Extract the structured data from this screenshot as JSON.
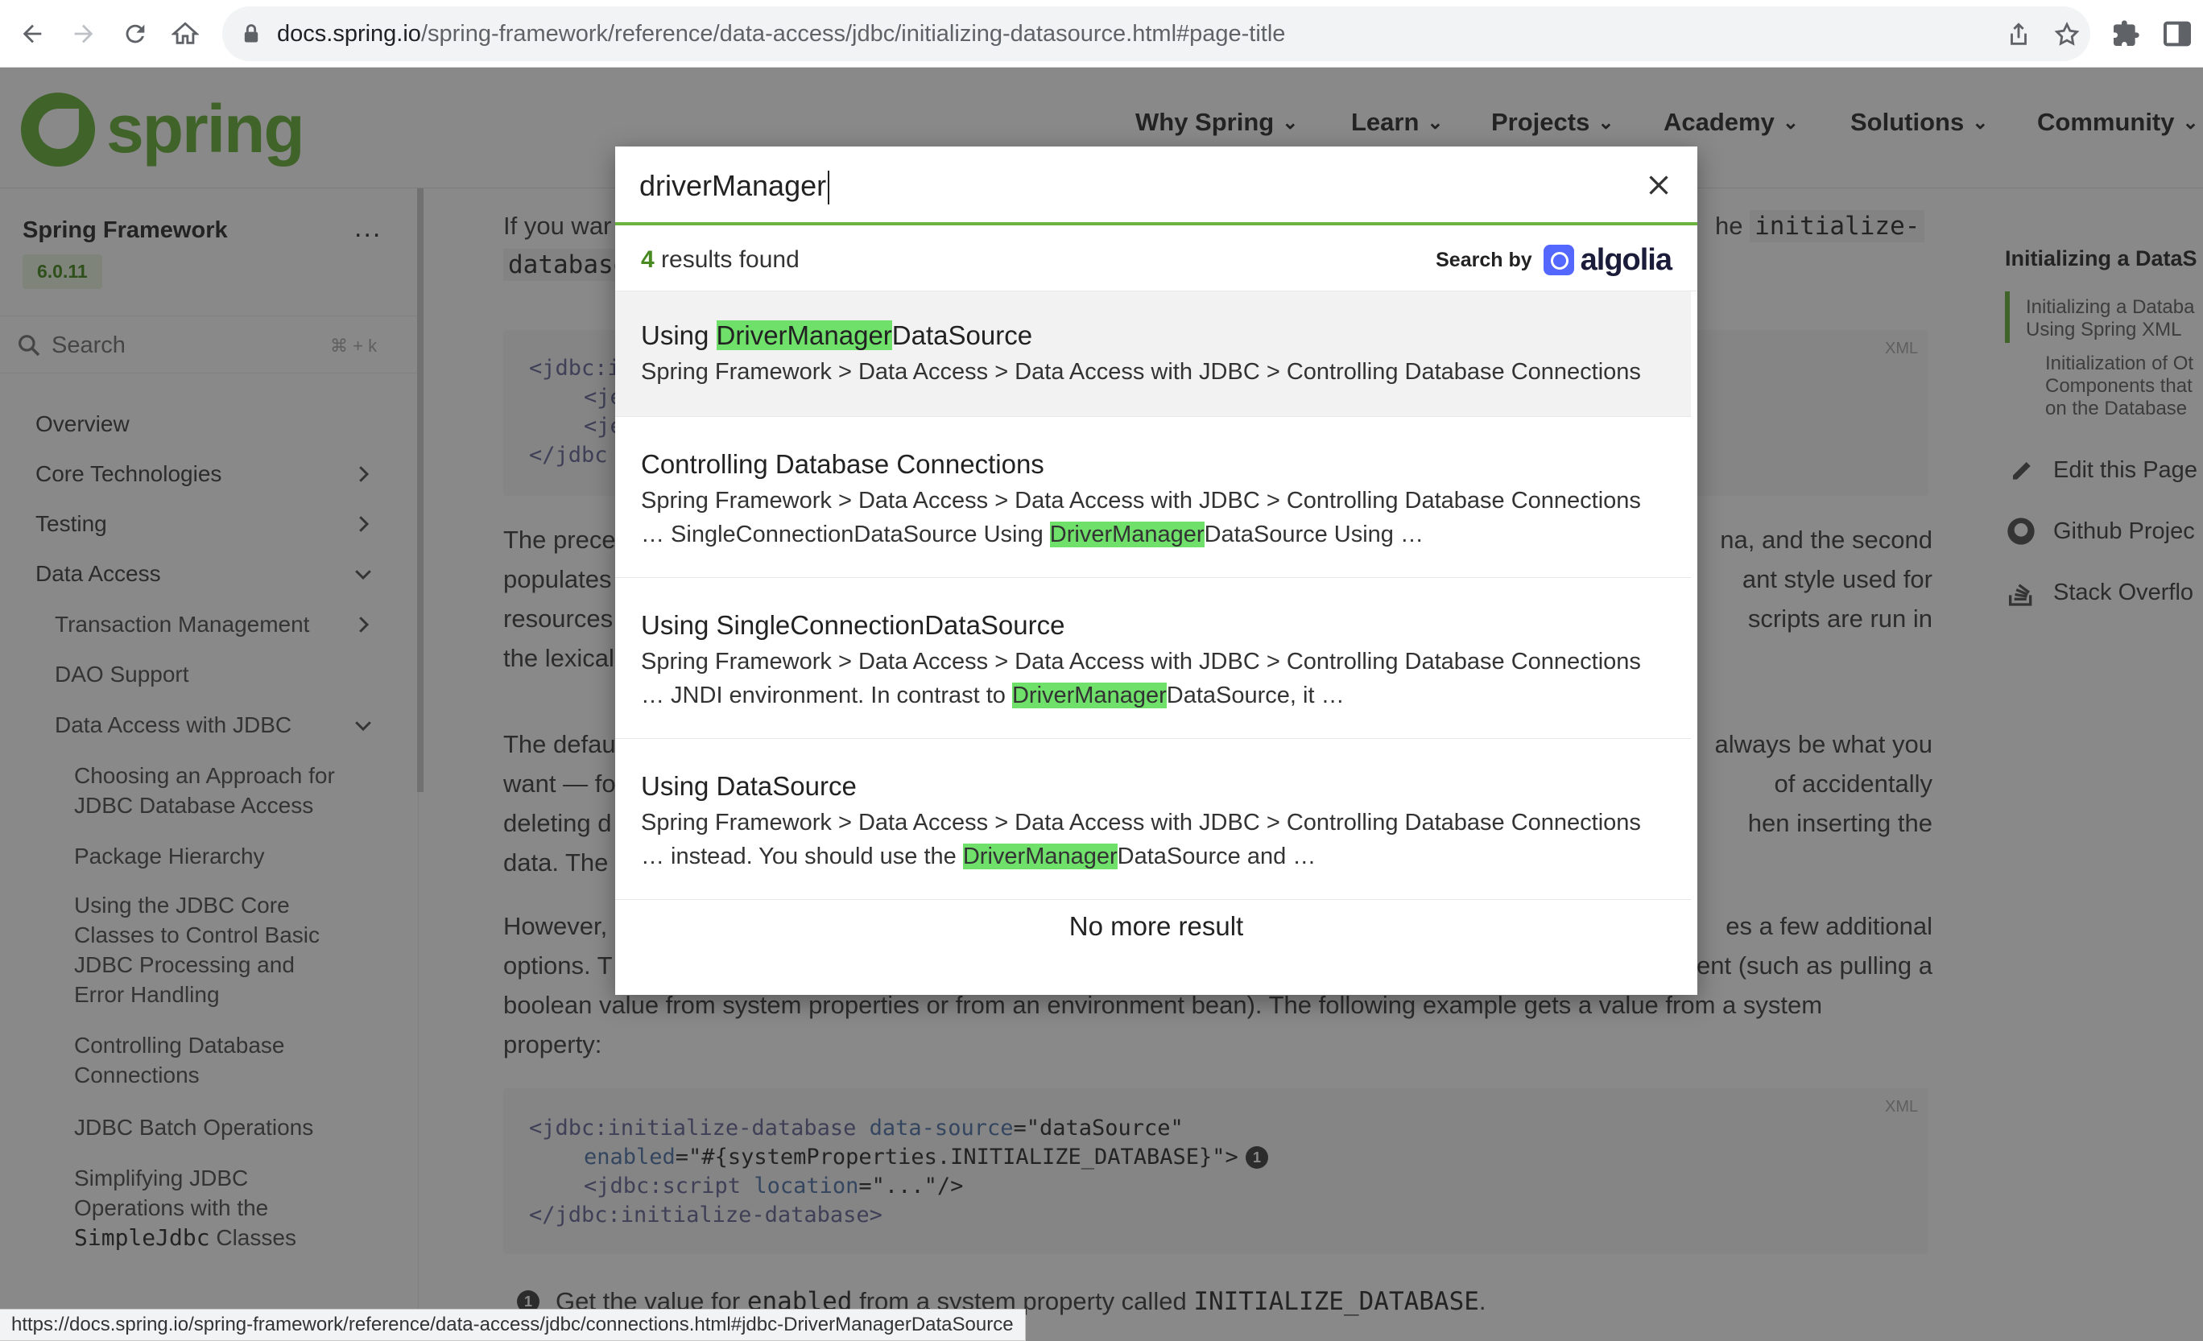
{
  "browser": {
    "url_host": "docs.spring.io",
    "url_path": "/spring-framework/reference/data-access/jdbc/initializing-datasource.html#page-title",
    "status_url": "https://docs.spring.io/spring-framework/reference/data-access/jdbc/connections.html#jdbc-DriverManagerDataSource"
  },
  "nav": {
    "logo": "spring",
    "menu": [
      "Why Spring",
      "Learn",
      "Projects",
      "Academy",
      "Solutions",
      "Community"
    ]
  },
  "sidebar": {
    "title": "Spring Framework",
    "more": "...",
    "version": "6.0.11",
    "search_label": "Search",
    "search_shortcut": "⌘ + k",
    "items": [
      {
        "label": "Overview"
      },
      {
        "label": "Core Technologies"
      },
      {
        "label": "Testing"
      },
      {
        "label": "Data Access"
      },
      {
        "label": "Transaction Management"
      },
      {
        "label": "DAO Support"
      },
      {
        "label": "Data Access with JDBC"
      },
      {
        "label": "Choosing an Approach for JDBC Database Access"
      },
      {
        "label": "Package Hierarchy"
      },
      {
        "label": "Using the JDBC Core Classes to Control Basic JDBC Processing and Error Handling"
      },
      {
        "label": "Controlling Database Connections"
      },
      {
        "label": "JDBC Batch Operations"
      },
      {
        "label": "Simplifying JDBC Operations with the"
      },
      {
        "label": "SimpleJdbc"
      },
      {
        "label": "Classes"
      }
    ]
  },
  "content": {
    "p1_start": "If you war",
    "p1_end": "he",
    "p1_code": "initialize-",
    "p1_code2": "database",
    "code1_lines": [
      "<jdbc:i",
      "<je",
      "<je",
      "</jdbc"
    ],
    "p2_lines_left": [
      "The prece",
      "populates",
      "resources",
      "the lexical"
    ],
    "p2_lines_right": [
      "na, and the second",
      "ant style used for",
      "scripts are run in"
    ],
    "p3_lines_left": [
      "The defau",
      "want — fo",
      "deleting d",
      "data. The"
    ],
    "p3_lines_right": [
      "always be what you",
      "of accidentally",
      "hen inserting the"
    ],
    "p4_line1_left": "However,",
    "p4_line1_right": "es a few additional",
    "p4_line2_left": "options. T",
    "p4_line2_right": "ent (such as pulling a",
    "p4_line3": "boolean value from system properties or from an environment bean). The following example gets a value from a system",
    "p4_line4": "property:",
    "xml_label": "XML",
    "code2": {
      "l1_tag": "<jdbc:initialize-database",
      "l1_attr": "data-source",
      "l1_val": "=\"dataSource\"",
      "l2_attr": "enabled",
      "l2_val": "=\"#{systemProperties.INITIALIZE_DATABASE}\">",
      "l3_tag": "<jdbc:script",
      "l3_attr": "location",
      "l3_val": "=\"...\"/>",
      "l4_tag": "</jdbc:initialize-database>"
    },
    "callout_num": "1",
    "note_pre": "Get the value for",
    "note_code": "enabled",
    "note_mid": "from a system property called",
    "note_code2": "INITIALIZE_DATABASE",
    "note_end": "."
  },
  "toc": {
    "title": "Initializing a DataS",
    "items": [
      "Initializing a Databa",
      "Using Spring XML",
      "Initialization of Ot",
      "Components that",
      "on the Database"
    ],
    "links": [
      "Edit this Page",
      "Github Projec",
      "Stack Overflo"
    ]
  },
  "search": {
    "query": "driverManager",
    "count": "4",
    "count_suffix": "results found",
    "search_by": "Search by",
    "provider": "algolia",
    "results": [
      {
        "title_pre": "Using ",
        "title_hl": "DriverManager",
        "title_post": "DataSource",
        "crumb": "Spring Framework > Data Access > Data Access with JDBC > Controlling Database Connections"
      },
      {
        "title": "Controlling Database Connections",
        "crumb": "Spring Framework > Data Access > Data Access with JDBC > Controlling Database Connections",
        "snip_pre": "… SingleConnectionDataSource Using ",
        "snip_hl": "DriverManager",
        "snip_post": "DataSource Using …"
      },
      {
        "title": "Using SingleConnectionDataSource",
        "crumb": "Spring Framework > Data Access > Data Access with JDBC > Controlling Database Connections",
        "snip_pre": "… JNDI environment. In contrast to ",
        "snip_hl": "DriverManager",
        "snip_post": "DataSource, it …"
      },
      {
        "title": "Using DataSource",
        "crumb": "Spring Framework > Data Access > Data Access with JDBC > Controlling Database Connections",
        "snip_pre": "… instead. You should use the ",
        "snip_hl": "DriverManager",
        "snip_post": "DataSource and …"
      }
    ],
    "no_more": "No more result"
  },
  "colors": {
    "spring_green": "#6db33f",
    "highlight": "#6fe06a",
    "algolia_blue": "#5468ff"
  }
}
